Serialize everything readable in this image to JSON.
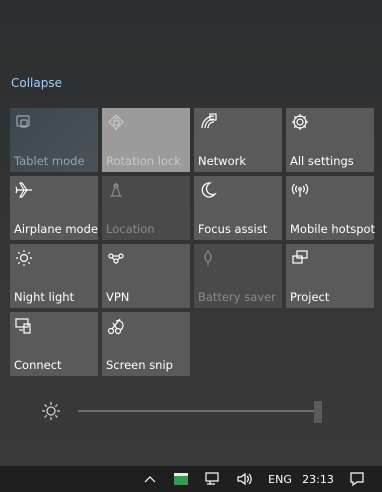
{
  "action_center": {
    "collapse_label": "Collapse",
    "tiles": [
      {
        "label": "Tablet mode",
        "icon": "tablet-mode-icon",
        "state": "disabled"
      },
      {
        "label": "Rotation lock",
        "icon": "rotation-lock-icon",
        "state": "disabled"
      },
      {
        "label": "Network",
        "icon": "network-icon",
        "state": "off"
      },
      {
        "label": "All settings",
        "icon": "gear-icon",
        "state": "off"
      },
      {
        "label": "Airplane mode",
        "icon": "airplane-icon",
        "state": "off"
      },
      {
        "label": "Location",
        "icon": "location-icon",
        "state": "disabled"
      },
      {
        "label": "Focus assist",
        "icon": "moon-icon",
        "state": "off"
      },
      {
        "label": "Mobile hotspot",
        "icon": "hotspot-icon",
        "state": "off"
      },
      {
        "label": "Night light",
        "icon": "night-light-icon",
        "state": "off"
      },
      {
        "label": "VPN",
        "icon": "vpn-icon",
        "state": "off"
      },
      {
        "label": "Battery saver",
        "icon": "battery-saver-icon",
        "state": "disabled"
      },
      {
        "label": "Project",
        "icon": "project-icon",
        "state": "off"
      },
      {
        "label": "Connect",
        "icon": "connect-icon",
        "state": "off"
      },
      {
        "label": "Screen snip",
        "icon": "screen-snip-icon",
        "state": "off"
      }
    ],
    "brightness": {
      "level": 1.0
    }
  },
  "taskbar": {
    "language": "ENG",
    "time": "23:13",
    "icons": [
      "chevron-up-icon",
      "app-tray-icon",
      "network-icon",
      "volume-icon",
      "notification-icon"
    ]
  },
  "colors": {
    "accent_link": "#9ccfff",
    "tile": "#5a5a5a",
    "tile_disabled": "#4a4a4a",
    "taskbar": "#1f1f1f"
  }
}
